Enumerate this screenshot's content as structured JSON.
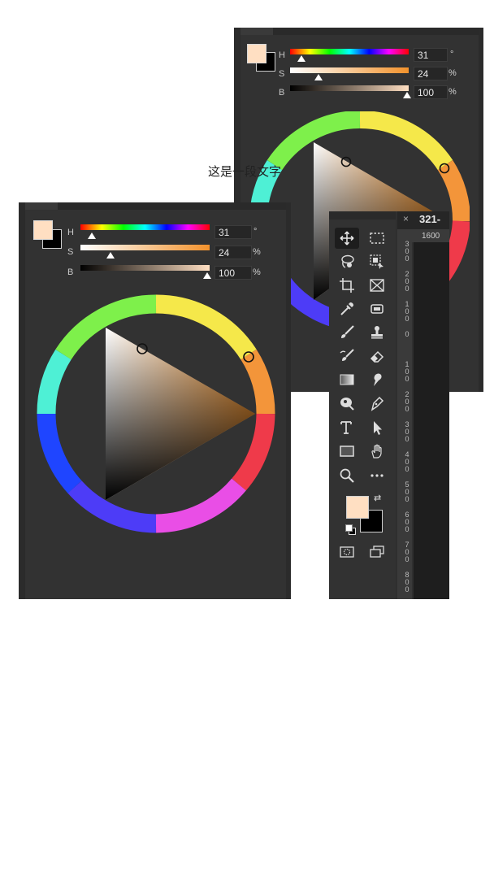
{
  "caption": "这是一段文字",
  "color_panels": [
    {
      "labels": {
        "h": "H",
        "s": "S",
        "b": "B"
      },
      "values": {
        "h": "31",
        "s": "24",
        "b": "100"
      },
      "units": {
        "h": "°",
        "s": "%",
        "b": "%"
      },
      "foreground_color": "#ffdfc2",
      "background_color": "#000000",
      "hue_level": 0.086,
      "saturation_level": 0.24,
      "brightness_level": 1.0
    },
    {
      "labels": {
        "h": "H",
        "s": "S",
        "b": "B"
      },
      "values": {
        "h": "31",
        "s": "24",
        "b": "100"
      },
      "units": {
        "h": "°",
        "s": "%",
        "b": "%"
      },
      "foreground_color": "#ffdfc2",
      "background_color": "#000000",
      "hue_level": 0.086,
      "saturation_level": 0.24,
      "brightness_level": 1.0
    }
  ],
  "toolbar": {
    "close_glyph": "×",
    "tab_title": "321-",
    "ruler_h_value": "1600",
    "ruler_v_values": [
      "3\n0\n0",
      "2\n0\n0",
      "1\n0\n0",
      "0",
      "1\n0\n0",
      "2\n0\n0",
      "3\n0\n0",
      "4\n0\n0",
      "5\n0\n0",
      "6\n0\n0",
      "7\n0\n0",
      "8\n0\n0"
    ],
    "tools": [
      "move-tool",
      "marquee-tool",
      "lasso-tool",
      "object-select-tool",
      "crop-tool",
      "frame-tool",
      "eyedropper-tool",
      "healing-tool",
      "brush-tool",
      "stamp-tool",
      "history-brush-tool",
      "eraser-tool",
      "gradient-tool",
      "smudge-tool",
      "dodge-tool",
      "pen-tool",
      "type-tool",
      "path-select-tool",
      "rectangle-tool",
      "hand-tool",
      "zoom-tool",
      "more-tools"
    ],
    "foreground_color": "#ffdfc2",
    "background_color": "#000000"
  }
}
